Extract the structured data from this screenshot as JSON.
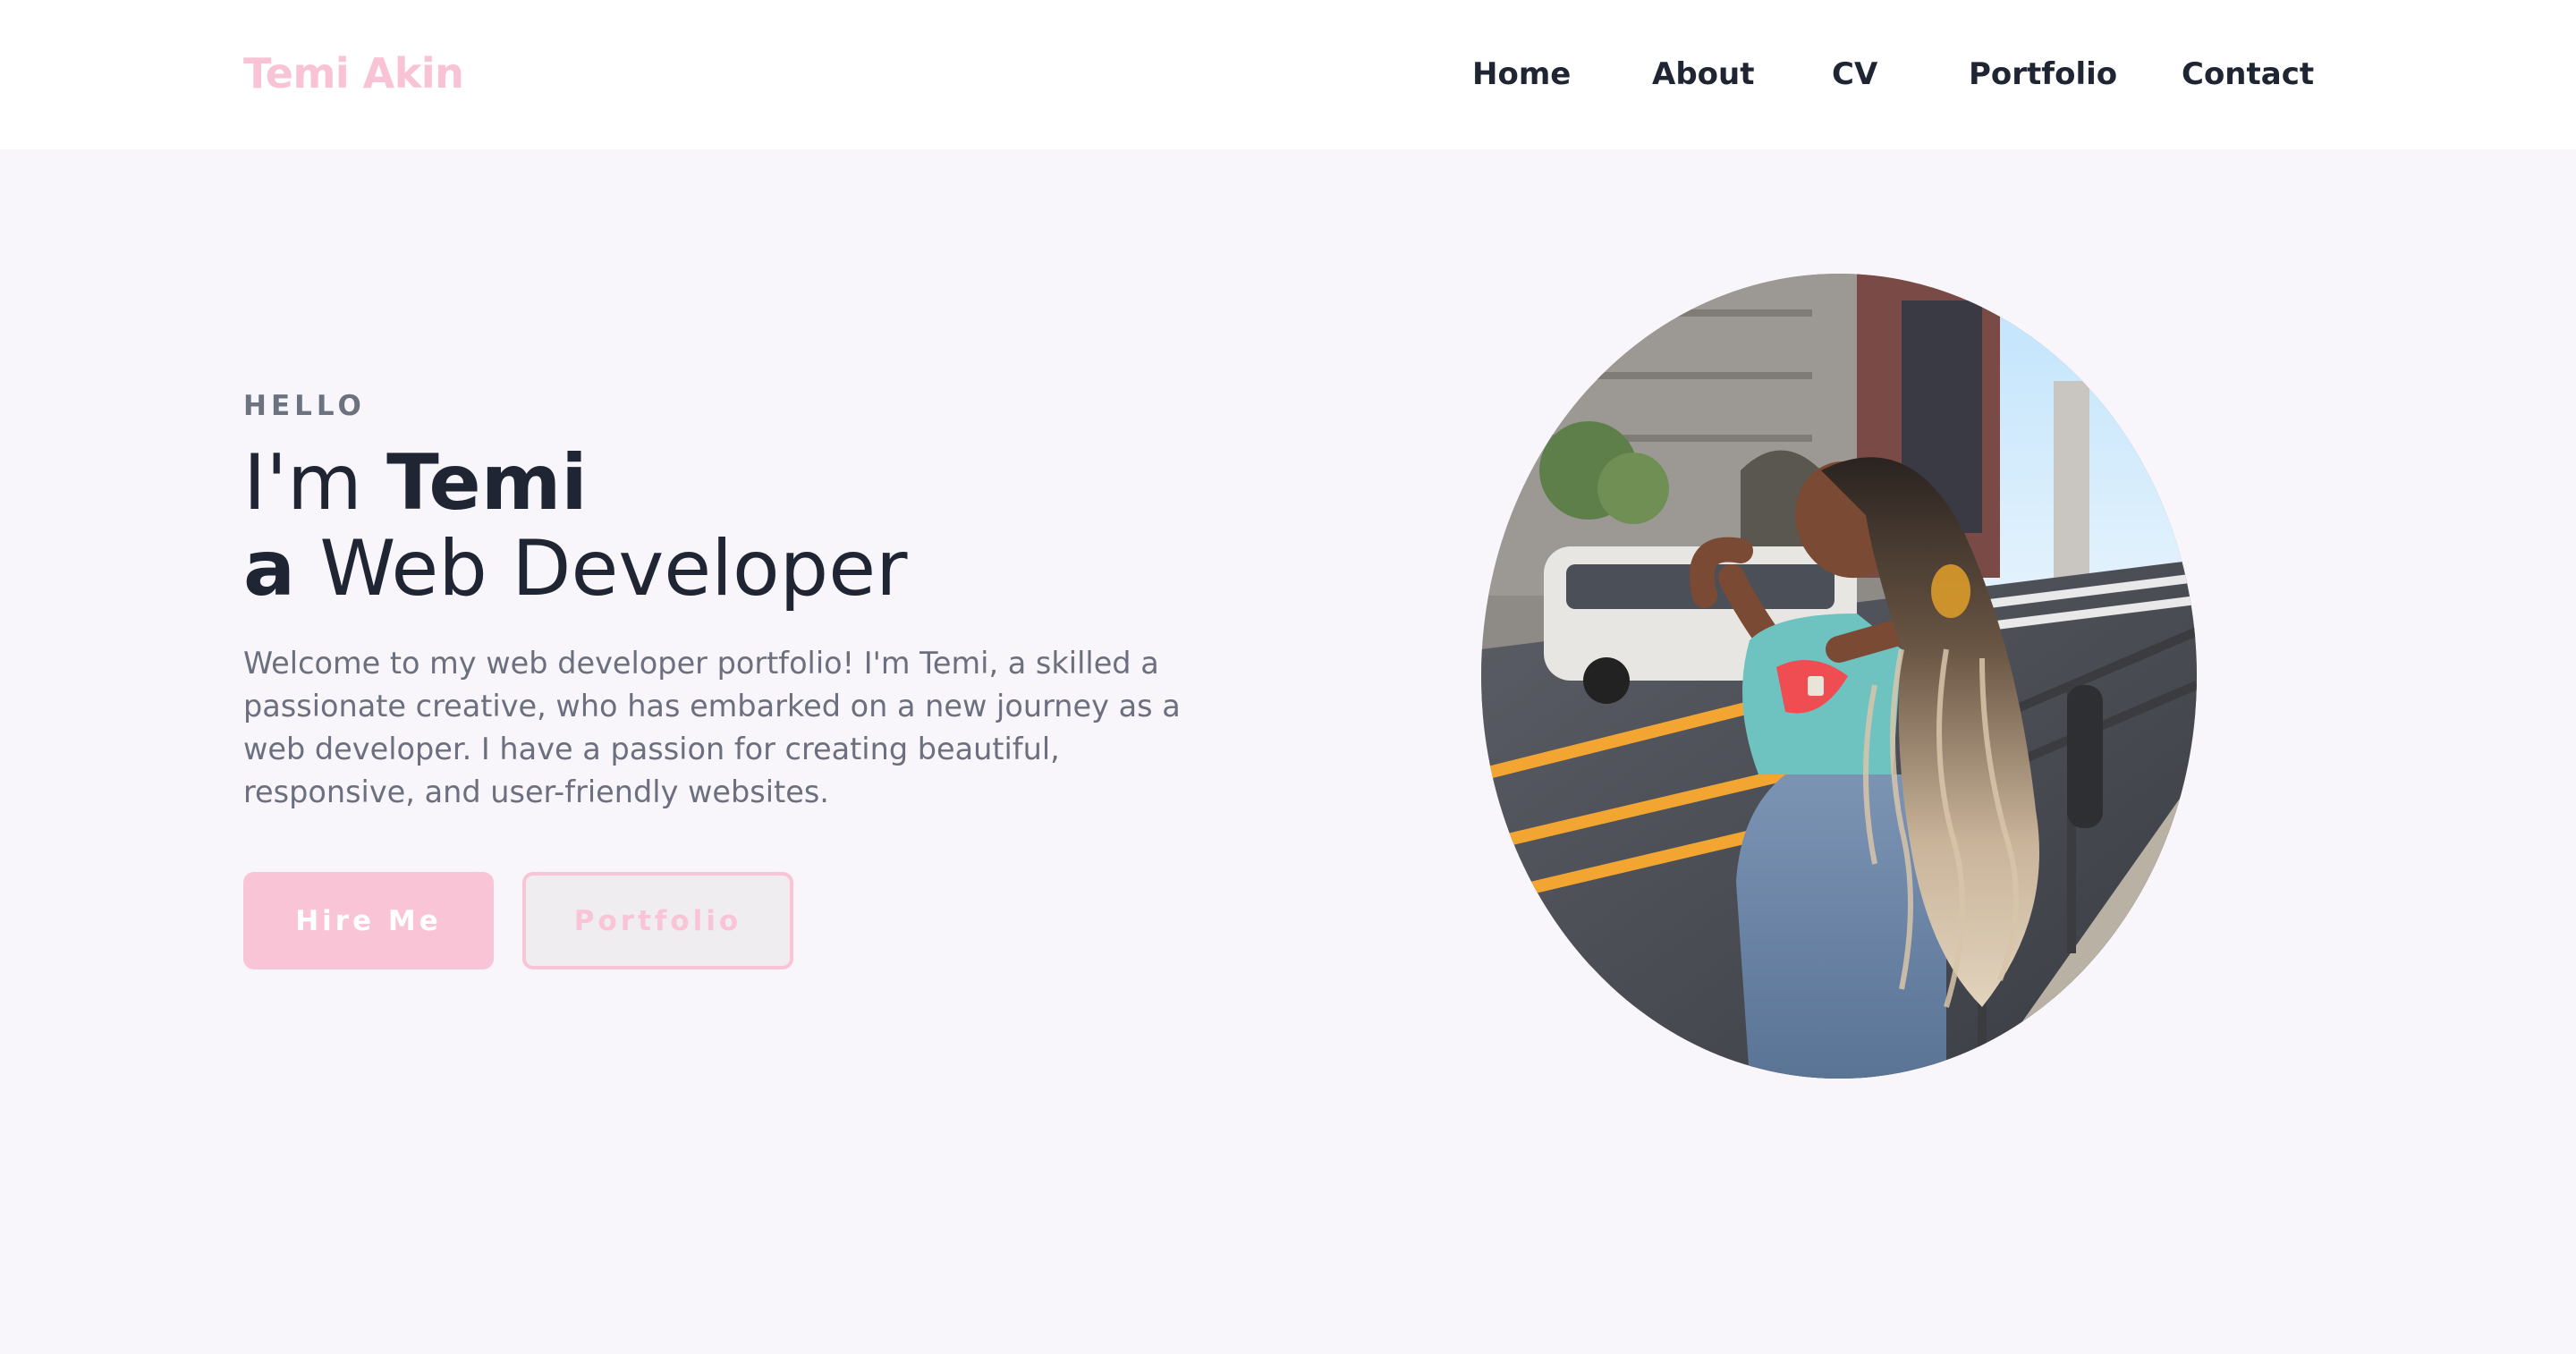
{
  "header": {
    "logo": "Temi Akin",
    "nav": [
      "Home",
      "About",
      "CV",
      "Portfolio",
      "Contact"
    ]
  },
  "hero": {
    "eyebrow": "HELLO",
    "line1_prefix": "I'm ",
    "line1_name": "Temi",
    "line2_prefix": "a",
    "line2_rest": " Web Developer",
    "bio": "Welcome to my web developer portfolio! I'm Temi, a skilled a passionate creative, who has embarked on a new journey as a web developer. I have a passion for creating beautiful, responsive, and user-friendly websites.",
    "hire_label": "Hire Me",
    "portfolio_label": "Portfolio"
  },
  "colors": {
    "accent": "#f8c4d6",
    "text_dark": "#1f2533",
    "text_muted": "#6b6f7e",
    "page_bg": "#f8f6fb"
  }
}
